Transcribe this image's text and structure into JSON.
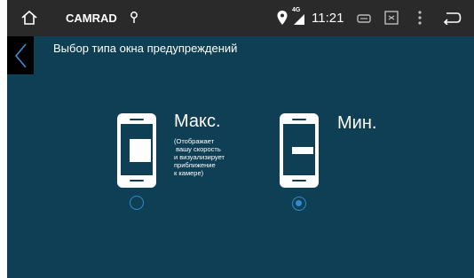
{
  "status_bar": {
    "app_name": "CAMRAD",
    "network": "4G",
    "time": "11:21"
  },
  "page": {
    "title": "Выбор типа окна предупреждений"
  },
  "options": [
    {
      "label": "Макс.",
      "description": "(Отображает\n вашу скорость\nи визуализирует\nприближение\nк камере)",
      "selected": false
    },
    {
      "label": "Мин.",
      "selected": true
    }
  ],
  "colors": {
    "background": "#0f3f55",
    "status_bar": "#2a2a2a",
    "accent": "#2f8ad0"
  },
  "icons": [
    "home-icon",
    "gps-icon",
    "location-icon",
    "signal-icon",
    "cast-icon",
    "screenshot-icon",
    "menu-icon",
    "back-icon",
    "chevron-left-icon",
    "phone-icon"
  ]
}
